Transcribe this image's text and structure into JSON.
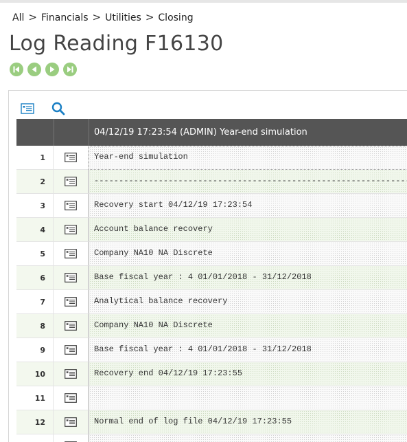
{
  "breadcrumb": {
    "items": [
      "All",
      "Financials",
      "Utilities",
      "Closing"
    ],
    "separator": ">"
  },
  "page_title": "Log Reading F16130",
  "grid": {
    "header": "04/12/19 17:23:54 (ADMIN) Year-end simulation",
    "rows": [
      {
        "num": "1",
        "text": "Year-end simulation"
      },
      {
        "num": "2",
        "text": "--------------------------------------------------------------------------------"
      },
      {
        "num": "3",
        "text": "Recovery start 04/12/19 17:23:54"
      },
      {
        "num": "4",
        "text": "Account balance recovery"
      },
      {
        "num": "5",
        "text": "Company NA10 NA Discrete"
      },
      {
        "num": "6",
        "text": "Base fiscal year : 4 01/01/2018 - 31/12/2018"
      },
      {
        "num": "7",
        "text": "Analytical balance recovery"
      },
      {
        "num": "8",
        "text": "Company NA10 NA Discrete"
      },
      {
        "num": "9",
        "text": "Base fiscal year : 4 01/01/2018 - 31/12/2018"
      },
      {
        "num": "10",
        "text": "Recovery end 04/12/19 17:23:55"
      },
      {
        "num": "11",
        "text": ""
      },
      {
        "num": "12",
        "text": "Normal end of log file 04/12/19 17:23:55"
      },
      {
        "num": "",
        "text": ""
      }
    ]
  },
  "icons": {
    "nav": [
      "first-record-icon",
      "previous-record-icon",
      "next-record-icon",
      "last-record-icon"
    ],
    "toolbar": [
      "detail-view-icon",
      "search-icon"
    ],
    "row": "row-detail-icon"
  },
  "colors": {
    "nav_button": "#9acd80",
    "header_bg": "#555555",
    "accent_blue": "#1a7fc4",
    "alt_row": "#f1f7ec"
  }
}
